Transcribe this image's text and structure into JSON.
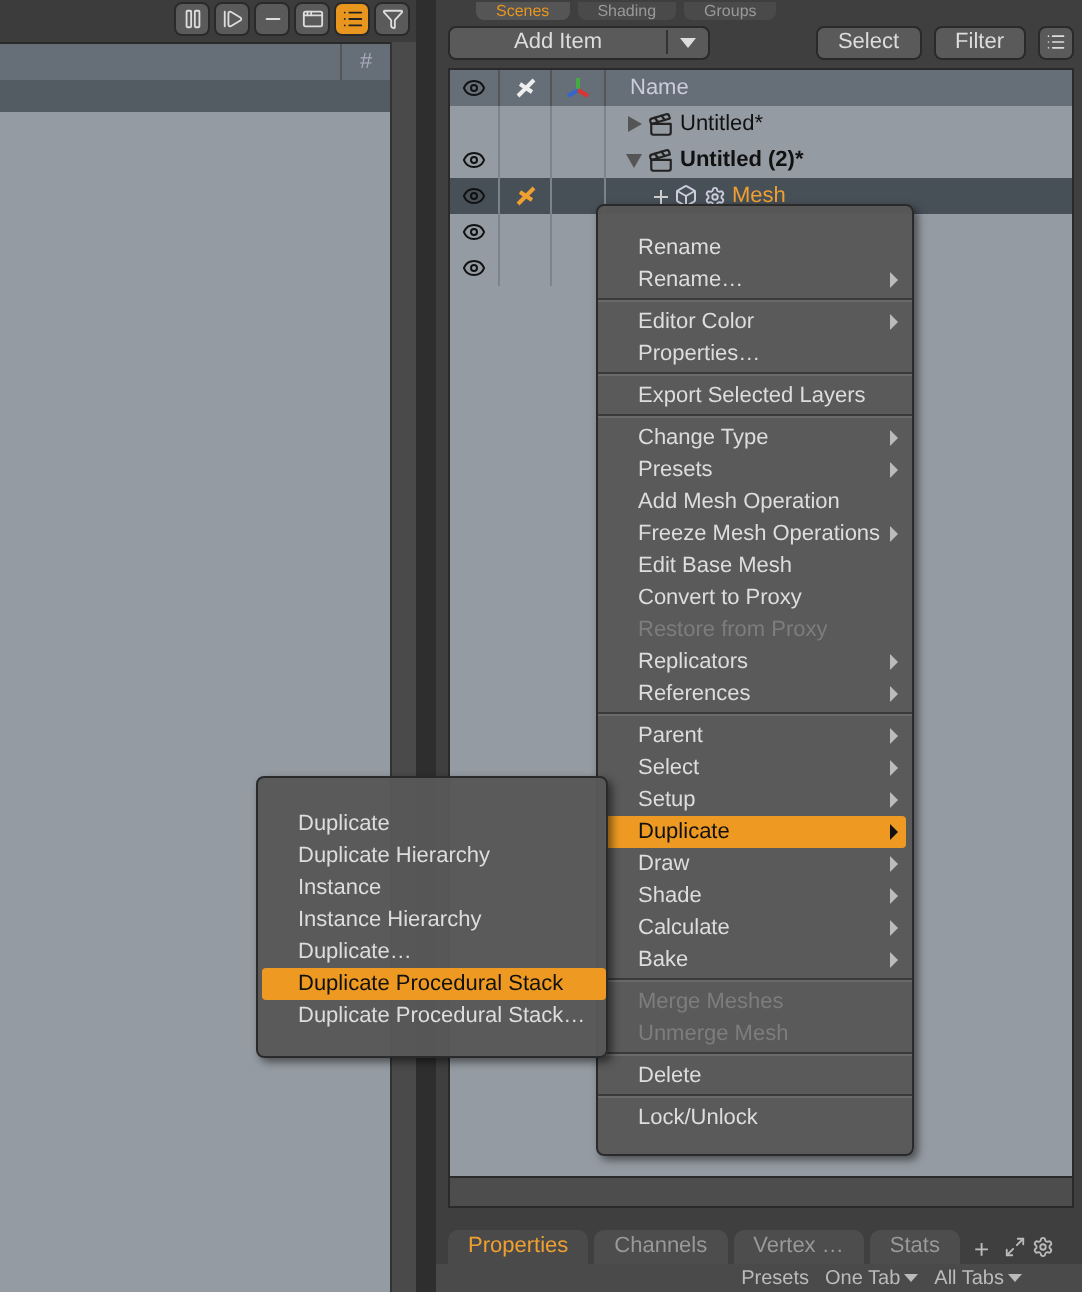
{
  "left_panel": {
    "toolbar": [
      {
        "kind": "pause",
        "on": false
      },
      {
        "kind": "step",
        "on": false
      },
      {
        "kind": "bar",
        "on": false
      },
      {
        "kind": "window",
        "on": false
      },
      {
        "kind": "list",
        "on": true
      },
      {
        "kind": "filter",
        "on": false
      }
    ],
    "column_header": "#"
  },
  "scene_tabs": [
    {
      "label": "Scenes",
      "selected": true
    },
    {
      "label": "Shading",
      "selected": false
    },
    {
      "label": "Groups",
      "selected": false
    }
  ],
  "toolbar": {
    "add_item": "Add Item",
    "buttons": [
      "Select",
      "Filter"
    ]
  },
  "table": {
    "name_header": "Name",
    "rows": [
      {
        "name": "Untitled*",
        "kind": "scene",
        "expanded": false,
        "visible": false,
        "current": false,
        "selected": false
      },
      {
        "name": "Untitled (2)*",
        "kind": "scene",
        "expanded": true,
        "visible": true,
        "current": true,
        "selected": false
      },
      {
        "name": "Mesh",
        "kind": "mesh",
        "visible": true,
        "current": false,
        "selected": true
      },
      {
        "kind": "covered",
        "visible": true,
        "selected": false
      },
      {
        "kind": "covered",
        "visible": true,
        "selected": false
      }
    ]
  },
  "context_menu": {
    "groups": [
      [
        {
          "label": "Rename",
          "submenu": false,
          "disabled": false,
          "selected": false
        },
        {
          "label": "Rename…",
          "submenu": true,
          "disabled": false,
          "selected": false
        }
      ],
      [
        {
          "label": "Editor Color",
          "submenu": true,
          "disabled": false,
          "selected": false
        },
        {
          "label": "Properties…",
          "submenu": false,
          "disabled": false,
          "selected": false
        }
      ],
      [
        {
          "label": "Export Selected Layers",
          "submenu": false,
          "disabled": false,
          "selected": false
        }
      ],
      [
        {
          "label": "Change Type",
          "submenu": true,
          "disabled": false,
          "selected": false
        },
        {
          "label": "Presets",
          "submenu": true,
          "disabled": false,
          "selected": false
        },
        {
          "label": "Add Mesh Operation",
          "submenu": false,
          "disabled": false,
          "selected": false
        },
        {
          "label": "Freeze Mesh Operations",
          "submenu": true,
          "disabled": false,
          "selected": false
        },
        {
          "label": "Edit Base Mesh",
          "submenu": false,
          "disabled": false,
          "selected": false
        },
        {
          "label": "Convert to Proxy",
          "submenu": false,
          "disabled": false,
          "selected": false
        },
        {
          "label": "Restore from Proxy",
          "submenu": false,
          "disabled": true,
          "selected": false
        },
        {
          "label": "Replicators",
          "submenu": true,
          "disabled": false,
          "selected": false
        },
        {
          "label": "References",
          "submenu": true,
          "disabled": false,
          "selected": false
        }
      ],
      [
        {
          "label": "Parent",
          "submenu": true,
          "disabled": false,
          "selected": false
        },
        {
          "label": "Select",
          "submenu": true,
          "disabled": false,
          "selected": false
        },
        {
          "label": "Setup",
          "submenu": true,
          "disabled": false,
          "selected": false
        },
        {
          "label": "Duplicate",
          "submenu": true,
          "disabled": false,
          "selected": true
        },
        {
          "label": "Draw",
          "submenu": true,
          "disabled": false,
          "selected": false
        },
        {
          "label": "Shade",
          "submenu": true,
          "disabled": false,
          "selected": false
        },
        {
          "label": "Calculate",
          "submenu": true,
          "disabled": false,
          "selected": false
        },
        {
          "label": "Bake",
          "submenu": true,
          "disabled": false,
          "selected": false
        }
      ],
      [
        {
          "label": "Merge Meshes",
          "submenu": false,
          "disabled": true,
          "selected": false
        },
        {
          "label": "Unmerge Mesh",
          "submenu": false,
          "disabled": true,
          "selected": false
        }
      ],
      [
        {
          "label": "Delete",
          "submenu": false,
          "disabled": false,
          "selected": false
        }
      ],
      [
        {
          "label": "Lock/Unlock",
          "submenu": false,
          "disabled": false,
          "selected": false
        }
      ]
    ]
  },
  "submenu": [
    {
      "label": "Duplicate",
      "selected": false
    },
    {
      "label": "Duplicate Hierarchy",
      "selected": false
    },
    {
      "label": "Instance",
      "selected": false
    },
    {
      "label": "Instance Hierarchy",
      "selected": false
    },
    {
      "label": "Duplicate…",
      "selected": false
    },
    {
      "label": "Duplicate Procedural Stack",
      "selected": true
    },
    {
      "label": "Duplicate Procedural Stack…",
      "selected": false
    }
  ],
  "bottom_tabs": [
    {
      "label": "Properties",
      "selected": true
    },
    {
      "label": "Channels",
      "selected": false
    },
    {
      "label": "Vertex  …",
      "selected": false
    },
    {
      "label": "Stats",
      "selected": false
    }
  ],
  "add_tab": "+",
  "footer": [
    {
      "label": "Presets",
      "dropdown": false
    },
    {
      "label": "One Tab",
      "dropdown": true
    },
    {
      "label": "All Tabs",
      "dropdown": true
    }
  ]
}
